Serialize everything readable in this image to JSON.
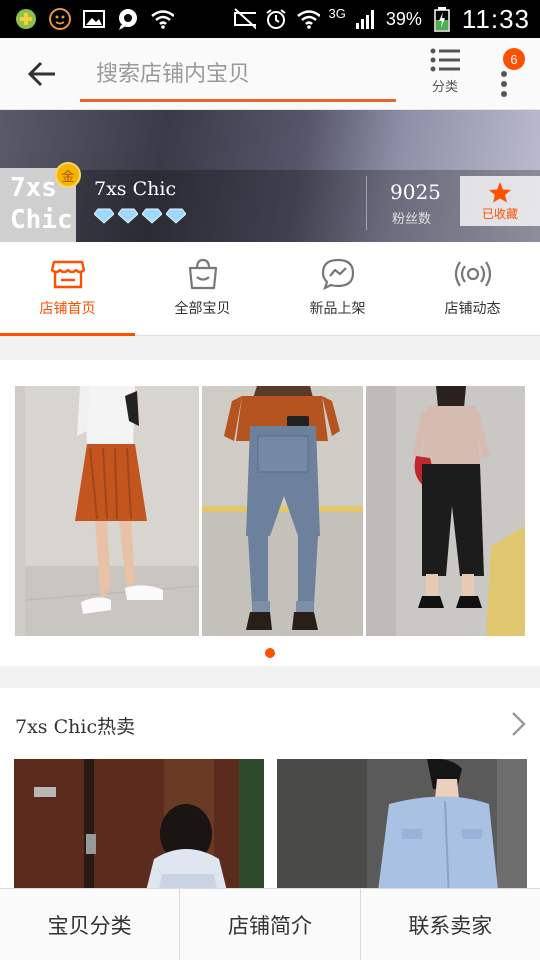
{
  "status_bar": {
    "net_type": "3G",
    "battery": "39%",
    "time": "11:33"
  },
  "header": {
    "search_placeholder": "搜索店铺内宝贝",
    "category_label": "分类",
    "notification_count": "6"
  },
  "shop": {
    "logo_text_line1": "7xs",
    "logo_text_line2": "Chic",
    "gold_badge": "金",
    "name": "7xs Chic",
    "diamond_count": 4,
    "fans_count": "9025",
    "fans_label": "粉丝数",
    "favorite_label": "已收藏"
  },
  "tabs": [
    {
      "label": "店铺首页",
      "icon": "store-icon",
      "active": true
    },
    {
      "label": "全部宝贝",
      "icon": "bag-icon",
      "active": false
    },
    {
      "label": "新品上架",
      "icon": "chat-lightning-icon",
      "active": false
    },
    {
      "label": "店铺动态",
      "icon": "broadcast-icon",
      "active": false
    }
  ],
  "carousel": {
    "active_index": 0,
    "page_count": 1
  },
  "hot": {
    "title": "7xs Chic热卖"
  },
  "bottom_bar": {
    "items": [
      "宝贝分类",
      "店铺简介",
      "联系卖家"
    ]
  },
  "colors": {
    "accent": "#ff5000",
    "search_underline": "#e8622a"
  }
}
